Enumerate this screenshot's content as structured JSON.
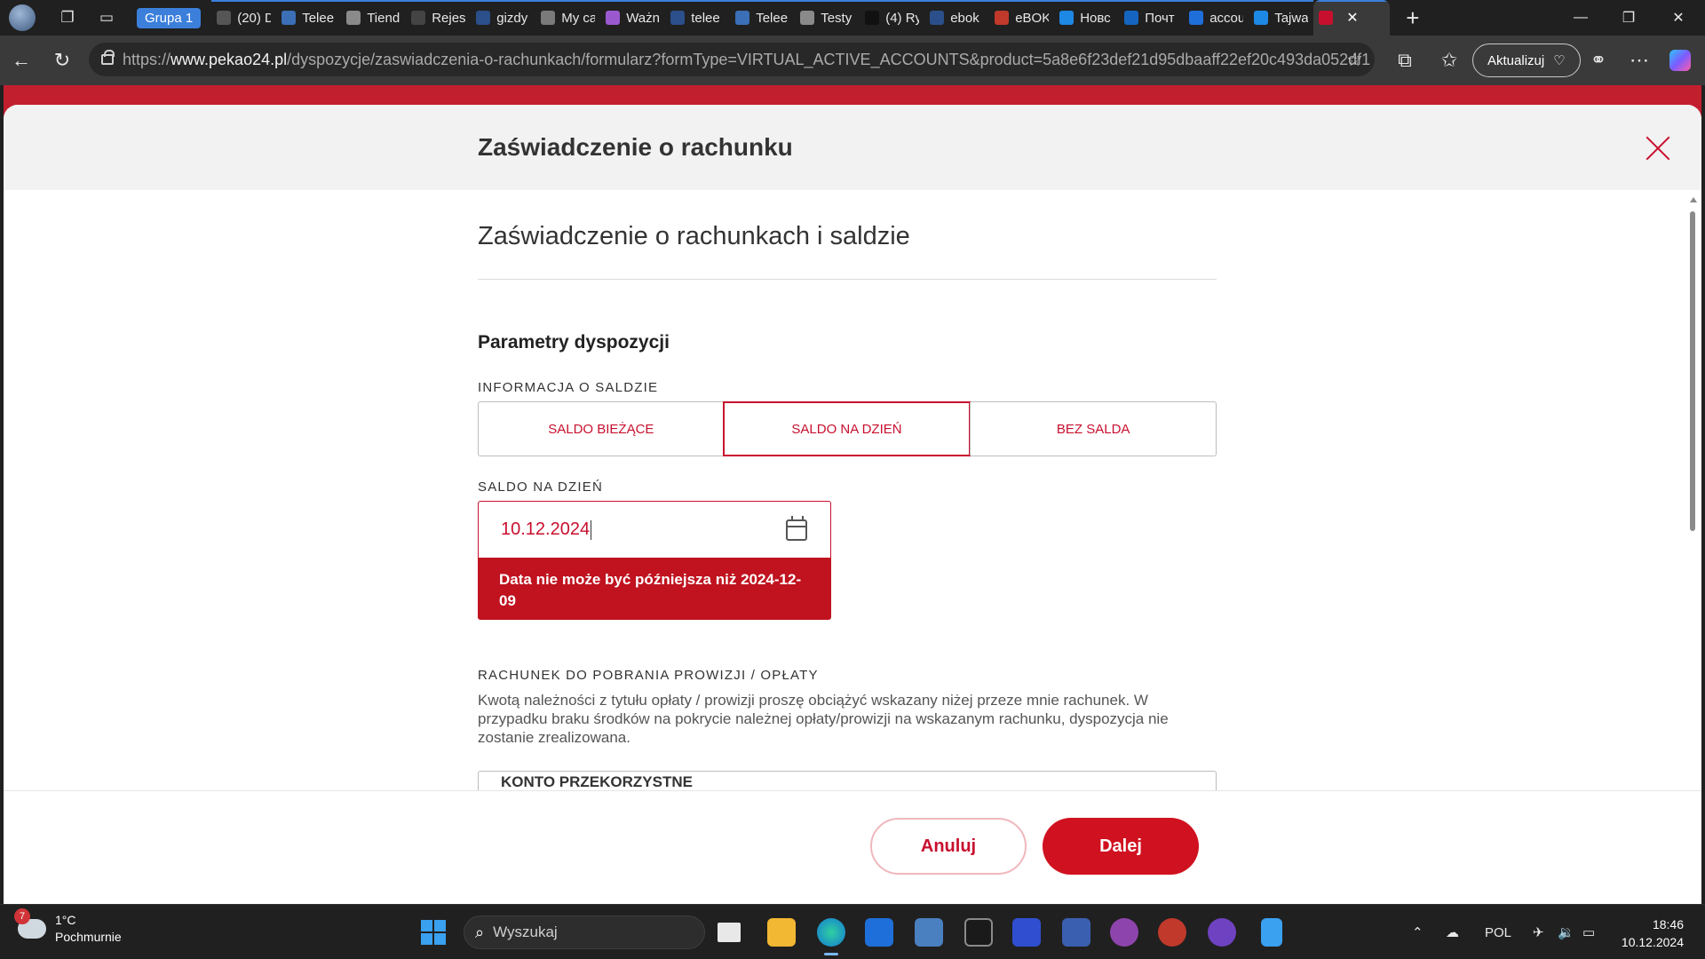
{
  "browser": {
    "tab_group_label": "Grupa 1",
    "tabs": [
      {
        "label": "(20) D",
        "color": "#555555"
      },
      {
        "label": "Telee",
        "color": "#3b6fb6"
      },
      {
        "label": "Tiend",
        "color": "#8a8a8a"
      },
      {
        "label": "Rejes",
        "color": "#444444"
      },
      {
        "label": "gizdy",
        "color": "#2b4f8a"
      },
      {
        "label": "My ca",
        "color": "#7a7a7a"
      },
      {
        "label": "Ważn",
        "color": "#9b59d0"
      },
      {
        "label": "telee",
        "color": "#2b4f8a"
      },
      {
        "label": "Telee",
        "color": "#3b6fb6"
      },
      {
        "label": "Testy",
        "color": "#8a8a8a"
      },
      {
        "label": "(4) Ry",
        "color": "#111111"
      },
      {
        "label": "ebok",
        "color": "#2b4f8a"
      },
      {
        "label": "eBOK",
        "color": "#c0392b"
      },
      {
        "label": "Новс",
        "color": "#1e88e5"
      },
      {
        "label": "Почт",
        "color": "#1565c0"
      },
      {
        "label": "accou",
        "color": "#1e6fd9"
      },
      {
        "label": "Tajwa",
        "color": "#1e88e5"
      },
      {
        "label": "",
        "color": "#c8102e",
        "active": true
      }
    ],
    "url_scheme": "https://",
    "url_host": "www.pekao24.pl",
    "url_path": "/dyspozycje/zaswiadczenia-o-rachunkach/formularz?formType=VIRTUAL_ACTIVE_ACCOUNTS&product=5a8e6f23def21d95dbaaff22ef20c493da052df1",
    "update_label": "Aktualizuj"
  },
  "modal": {
    "title": "Zaświadczenie o rachunku",
    "form_title": "Zaświadczenie o rachunkach i saldzie",
    "section_title": "Parametry dyspozycji",
    "balance_info_label": "INFORMACJA O SALDZIE",
    "balance_options": [
      "SALDO BIEŻĄCE",
      "SALDO NA DZIEŃ",
      "BEZ SALDA"
    ],
    "balance_selected": "SALDO NA DZIEŃ",
    "date_label": "SALDO NA DZIEŃ",
    "date_value": "10.12.2024",
    "date_error": "Data nie może być późniejsza niż 2024-12-09",
    "fee_account_label": "RACHUNEK DO POBRANIA PROWIZJI / OPŁATY",
    "fee_account_desc": "Kwotą należności z tytułu opłaty / prowizji proszę obciążyć wskazany niżej przeze mnie rachunek. W przypadku braku środków na pokrycie należnej opłaty/prowizji na wskazanym rachunku, dyspozycja nie zostanie zrealizowana.",
    "account_value": "KONTO PRZEKORZYSTNE",
    "cancel_label": "Anuluj",
    "next_label": "Dalej",
    "accent_color": "#c8102e"
  },
  "taskbar": {
    "weather_badge": "7",
    "weather_temp": "1°C",
    "weather_desc": "Pochmurnie",
    "search_placeholder": "Wyszukaj",
    "language": "POL",
    "time": "18:46",
    "date": "10.12.2024"
  }
}
